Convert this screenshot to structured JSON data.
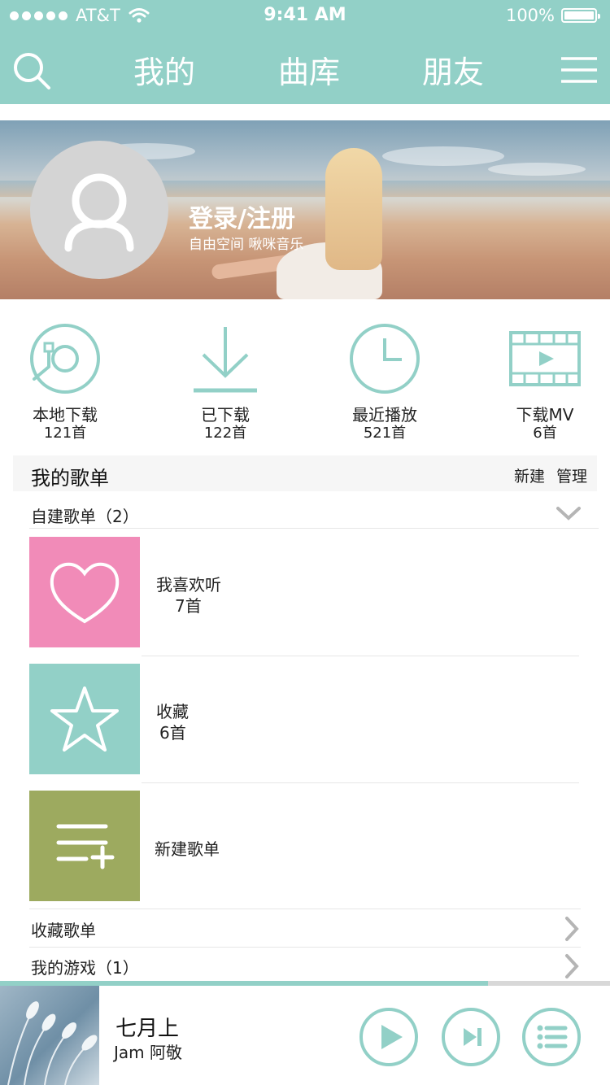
{
  "status_bar": {
    "carrier": "AT&T",
    "time": "9:41 AM",
    "battery": "100%"
  },
  "nav": {
    "tabs": [
      {
        "label": "我的"
      },
      {
        "label": "曲库"
      },
      {
        "label": "朋友"
      }
    ],
    "search_icon": "search-icon",
    "menu_icon": "hamburger-menu-icon"
  },
  "profile": {
    "login_label": "登录/注册",
    "subtitle": "自由空间 啾咪音乐"
  },
  "quick_actions": [
    {
      "label": "本地下载",
      "count": "121首",
      "icon": "vinyl-disc-icon"
    },
    {
      "label": "已下载",
      "count": "122首",
      "icon": "download-icon"
    },
    {
      "label": "最近播放",
      "count": "521首",
      "icon": "clock-icon"
    },
    {
      "label": "下载MV",
      "count": "6首",
      "icon": "film-play-icon"
    }
  ],
  "my_playlists": {
    "title": "我的歌单",
    "new_label": "新建",
    "manage_label": "管理",
    "custom_section": "自建歌单（2）",
    "items": [
      {
        "name": "我喜欢听",
        "count": "7首",
        "color": "#f18bb8",
        "icon": "heart-icon"
      },
      {
        "name": "收藏",
        "count": "6首",
        "color": "#92d0c7",
        "icon": "star-icon"
      },
      {
        "name": "新建歌单",
        "count": "",
        "color": "#9daa5f",
        "icon": "add-playlist-icon"
      }
    ],
    "collected_section": "收藏歌单",
    "games_section": "我的游戏（1）"
  },
  "player": {
    "song_title": "七月上",
    "artist": "Jam 阿敬",
    "progress": 0.8
  },
  "colors": {
    "accent": "#92d0c7",
    "pink": "#f18bb8",
    "olive": "#9daa5f"
  }
}
